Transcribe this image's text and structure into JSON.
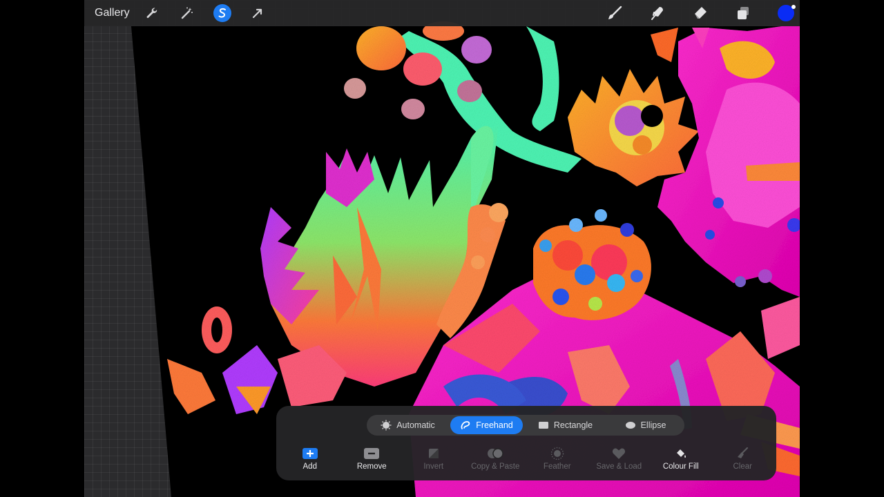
{
  "topbar": {
    "gallery_label": "Gallery",
    "tools_left": [
      {
        "name": "actions",
        "icon": "wrench-icon"
      },
      {
        "name": "adjustments",
        "icon": "magic-wand-icon"
      },
      {
        "name": "selection",
        "icon": "selection-s-icon",
        "active": true
      },
      {
        "name": "transform",
        "icon": "arrow-cursor-icon"
      }
    ],
    "tools_right": [
      {
        "name": "paint",
        "icon": "brush-icon"
      },
      {
        "name": "smudge",
        "icon": "smudge-finger-icon"
      },
      {
        "name": "erase",
        "icon": "eraser-icon"
      },
      {
        "name": "layers",
        "icon": "layers-icon"
      }
    ],
    "current_color": "#0a2cf5"
  },
  "selection_panel": {
    "modes": [
      {
        "label": "Automatic",
        "icon": "auto-select-icon",
        "active": false
      },
      {
        "label": "Freehand",
        "icon": "freehand-lasso-icon",
        "active": true
      },
      {
        "label": "Rectangle",
        "icon": "rectangle-icon",
        "active": false
      },
      {
        "label": "Ellipse",
        "icon": "ellipse-icon",
        "active": false
      }
    ],
    "actions": [
      {
        "label": "Add",
        "icon": "plus-square-icon",
        "enabled": true
      },
      {
        "label": "Remove",
        "icon": "minus-square-icon",
        "enabled": true
      },
      {
        "label": "Invert",
        "icon": "invert-icon",
        "enabled": false
      },
      {
        "label": "Copy & Paste",
        "icon": "copy-paste-icon",
        "enabled": false
      },
      {
        "label": "Feather",
        "icon": "feather-icon",
        "enabled": false
      },
      {
        "label": "Save & Load",
        "icon": "heart-icon",
        "enabled": false
      },
      {
        "label": "Colour Fill",
        "icon": "paint-bucket-icon",
        "enabled": true
      },
      {
        "label": "Clear",
        "icon": "clear-brush-icon",
        "enabled": false
      }
    ]
  },
  "colors": {
    "accent": "#1e7cf2",
    "canvas_bg": "#000000",
    "panel_bg": "#242426"
  }
}
